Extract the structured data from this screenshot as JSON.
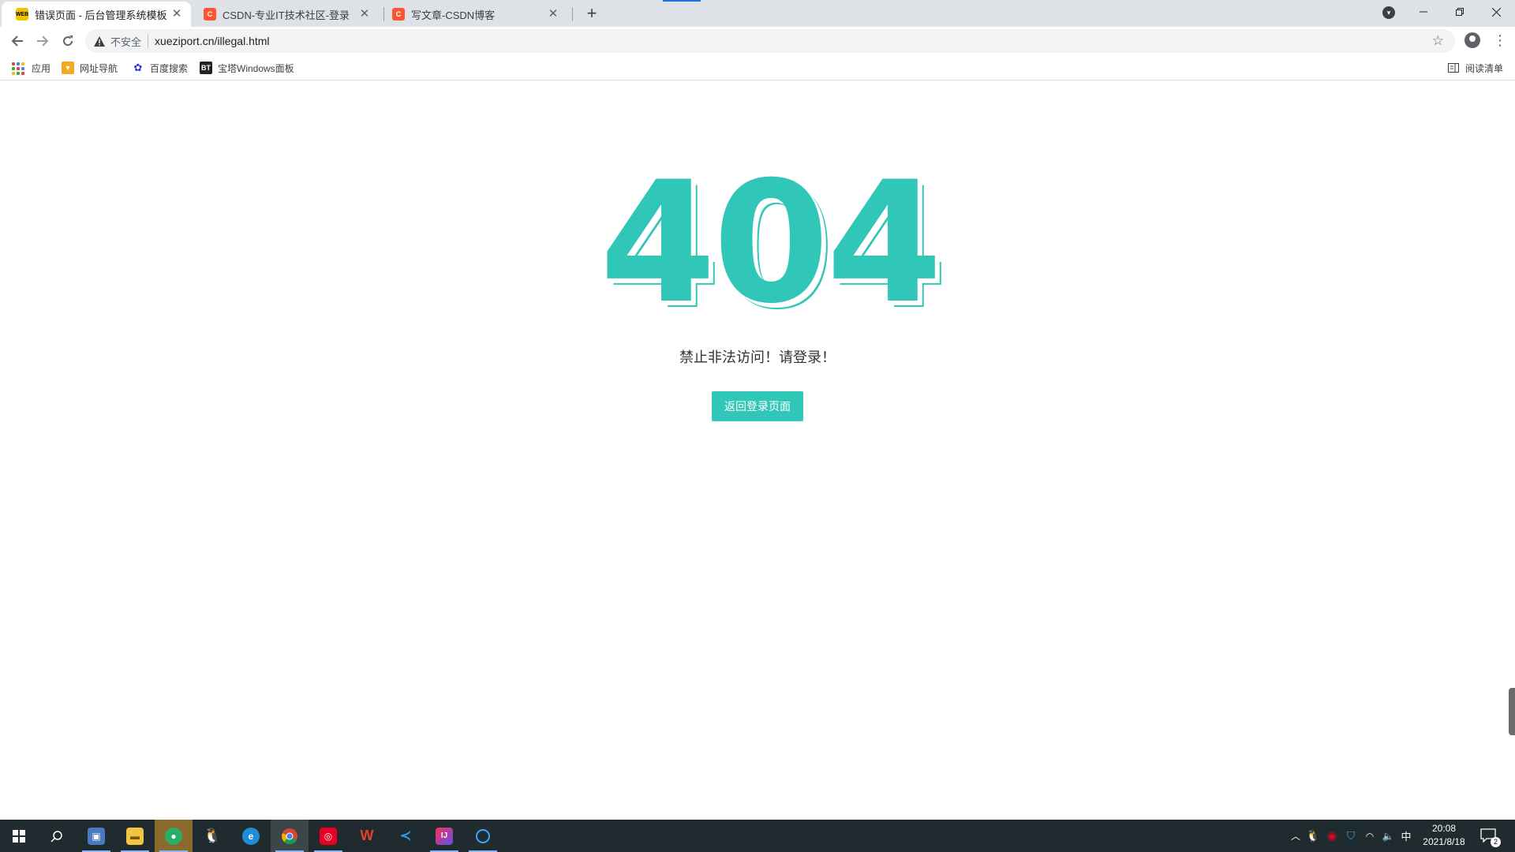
{
  "browser": {
    "tabs": [
      {
        "title": "错误页面 - 后台管理系统模板",
        "favicon": "web-icon",
        "favicon_text": "WEB",
        "active": true
      },
      {
        "title": "CSDN-专业IT技术社区-登录",
        "favicon": "csdn-icon",
        "favicon_text": "C",
        "active": false
      },
      {
        "title": "写文章-CSDN博客",
        "favicon": "csdn-icon",
        "favicon_text": "C",
        "active": false
      }
    ],
    "new_tab_symbol": "+",
    "address": {
      "security_label": "不安全",
      "url": "xueziport.cn/illegal.html"
    },
    "bookmarks": [
      {
        "label": "应用",
        "icon": "apps-grid-icon"
      },
      {
        "label": "网址导航",
        "icon": "nav-flag-icon"
      },
      {
        "label": "百度搜索",
        "icon": "baidu-paw-icon"
      },
      {
        "label": "宝塔Windows面板",
        "icon": "bt-panel-icon",
        "icon_text": "BT"
      }
    ],
    "reading_list": "阅读清单"
  },
  "page": {
    "code": "404",
    "message": "禁止非法访问！请登录！",
    "back_button": "返回登录页面",
    "accent_color": "#30c6b8"
  },
  "taskbar": {
    "clock_time": "20:08",
    "clock_date": "2021/8/18",
    "ime": "中",
    "notification_count": "2",
    "apps": [
      "windows-start-icon",
      "search-icon",
      "control-panel-icon",
      "file-explorer-icon",
      "wechat-icon",
      "qq-icon",
      "edge-icon",
      "chrome-icon",
      "netease-music-icon",
      "wps-icon",
      "vscode-icon",
      "intellij-icon",
      "photos-icon"
    ]
  }
}
